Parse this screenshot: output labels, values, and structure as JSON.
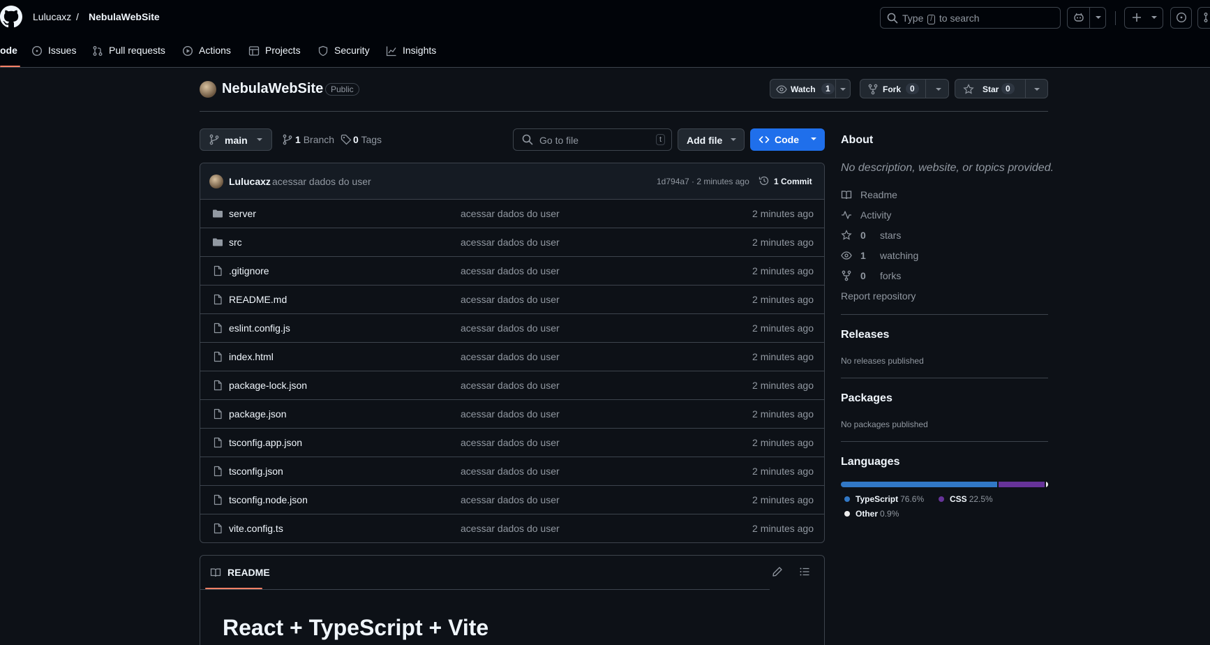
{
  "header": {
    "owner": "Lulucaxz",
    "separator": "/",
    "repo": "NebulaWebSite",
    "search_prefix": "Type",
    "search_key": "/",
    "search_suffix": "to search"
  },
  "nav": {
    "code": "Code",
    "code_visible": "ode",
    "issues": "Issues",
    "pull_requests": "Pull requests",
    "actions": "Actions",
    "projects": "Projects",
    "security": "Security",
    "insights": "Insights"
  },
  "repo": {
    "name": "NebulaWebSite",
    "visibility": "Public",
    "watch_label": "Watch",
    "watch_count": "1",
    "fork_label": "Fork",
    "fork_count": "0",
    "star_label": "Star",
    "star_count": "0"
  },
  "toolbar": {
    "branch": "main",
    "branch_count": "1",
    "branch_label": "Branch",
    "tag_count": "0",
    "tag_label": "Tags",
    "goto_placeholder": "Go to file",
    "goto_key": "t",
    "add_file": "Add file",
    "code": "Code"
  },
  "commit": {
    "author": "Lulucaxz",
    "message": "acessar dados do user",
    "meta": "1d794a7 · 2 minutes ago",
    "count_label": "1 Commit"
  },
  "files": [
    {
      "name": "server",
      "type": "folder",
      "message": "acessar dados do user",
      "date": "2 minutes ago"
    },
    {
      "name": "src",
      "type": "folder",
      "message": "acessar dados do user",
      "date": "2 minutes ago"
    },
    {
      "name": ".gitignore",
      "type": "file",
      "message": "acessar dados do user",
      "date": "2 minutes ago"
    },
    {
      "name": "README.md",
      "type": "file",
      "message": "acessar dados do user",
      "date": "2 minutes ago"
    },
    {
      "name": "eslint.config.js",
      "type": "file",
      "message": "acessar dados do user",
      "date": "2 minutes ago"
    },
    {
      "name": "index.html",
      "type": "file",
      "message": "acessar dados do user",
      "date": "2 minutes ago"
    },
    {
      "name": "package-lock.json",
      "type": "file",
      "message": "acessar dados do user",
      "date": "2 minutes ago"
    },
    {
      "name": "package.json",
      "type": "file",
      "message": "acessar dados do user",
      "date": "2 minutes ago"
    },
    {
      "name": "tsconfig.app.json",
      "type": "file",
      "message": "acessar dados do user",
      "date": "2 minutes ago"
    },
    {
      "name": "tsconfig.json",
      "type": "file",
      "message": "acessar dados do user",
      "date": "2 minutes ago"
    },
    {
      "name": "tsconfig.node.json",
      "type": "file",
      "message": "acessar dados do user",
      "date": "2 minutes ago"
    },
    {
      "name": "vite.config.ts",
      "type": "file",
      "message": "acessar dados do user",
      "date": "2 minutes ago"
    }
  ],
  "about": {
    "title": "About",
    "description": "No description, website, or topics provided.",
    "readme": "Readme",
    "activity": "Activity",
    "stars_count": "0",
    "stars_label": "stars",
    "watching_count": "1",
    "watching_label": "watching",
    "forks_count": "0",
    "forks_label": "forks",
    "report": "Report repository"
  },
  "releases": {
    "title": "Releases",
    "text": "No releases published"
  },
  "packages": {
    "title": "Packages",
    "text": "No packages published"
  },
  "languages": {
    "title": "Languages",
    "items": [
      {
        "name": "TypeScript",
        "percent": "76.6%",
        "value": 76.6,
        "color": "#3178c6"
      },
      {
        "name": "CSS",
        "percent": "22.5%",
        "value": 22.5,
        "color": "#663399"
      },
      {
        "name": "Other",
        "percent": "0.9%",
        "value": 0.9,
        "color": "#ededed"
      }
    ]
  },
  "readme": {
    "tab_label": "README",
    "heading": "React + TypeScript + Vite"
  },
  "colors": {
    "accent_blue": "#1f6feb",
    "tab_underline": "#f78166",
    "border": "#3d444d"
  }
}
